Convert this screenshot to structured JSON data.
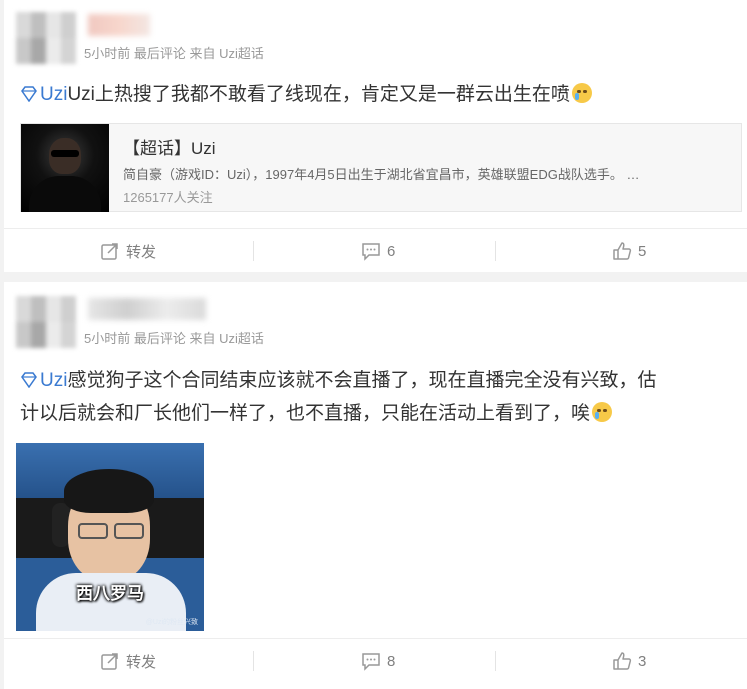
{
  "posts": [
    {
      "meta": "5小时前 最后评论 来自 Uzi超话",
      "topic": "Uzi",
      "text": "Uzi上热搜了我都不敢看了线现在，肯定又是一群云出生在喷",
      "topic_card": {
        "title": "【超话】Uzi",
        "description": "简自豪（游戏ID：Uzi），1997年4月5日出生于湖北省宜昌市，英雄联盟EDG战队选手。 …",
        "followers": "1265177人关注"
      },
      "actions": {
        "repost": "转发",
        "comments": "6",
        "likes": "5"
      }
    },
    {
      "meta": "5小时前 最后评论 来自 Uzi超话",
      "topic": "Uzi",
      "text_line1": "感觉狗子这个合同结束应该就不会直播了，现在直播完全没有兴致，估",
      "text_line2": "计以后就会和厂长他们一样了，也不直播，只能在活动上看到了，唉",
      "image_caption": "西八罗马",
      "image_watermark": "@Uzi的粉丝兴致",
      "actions": {
        "repost": "转发",
        "comments": "8",
        "likes": "3"
      }
    }
  ],
  "icons": {
    "diamond": "diamond-icon",
    "emoji": "crying-emoji-icon",
    "repost": "repost-icon",
    "comment": "comment-icon",
    "like": "thumbs-up-icon"
  },
  "colors": {
    "link": "#3a7ad1",
    "meta": "#999999",
    "background": "#f2f2f2"
  }
}
